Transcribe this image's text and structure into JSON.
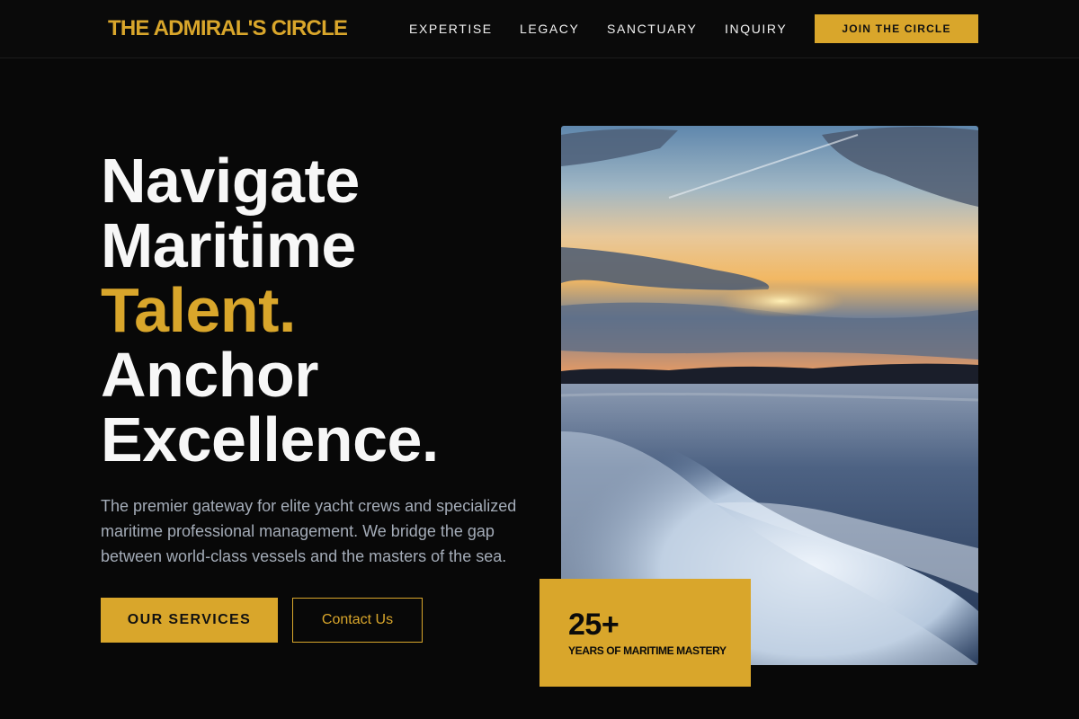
{
  "header": {
    "logo": "THE ADMIRAL'S CIRCLE",
    "nav": [
      {
        "label": "EXPERTISE"
      },
      {
        "label": "LEGACY"
      },
      {
        "label": "SANCTUARY"
      },
      {
        "label": "INQUIRY"
      }
    ],
    "cta_label": "JOIN THE CIRCLE"
  },
  "hero": {
    "headline_lines": [
      "Navigate",
      "Maritime",
      "Talent.",
      "Anchor",
      "Excellence."
    ],
    "lead": "The premier gateway for elite yacht crews and specialized maritime professional management. We bridge the gap between world-class vessels and the masters of the sea.",
    "primary_button": "OUR SERVICES",
    "secondary_button": "Contact Us",
    "image_subject": "sunset over water with boat wake",
    "stat": {
      "value": "25+",
      "label": "YEARS OF MARITIME MASTERY"
    }
  },
  "colors": {
    "accent": "#d9a62b",
    "background": "#080808",
    "text": "#f7f7f7",
    "muted_text": "#a4acb8"
  }
}
